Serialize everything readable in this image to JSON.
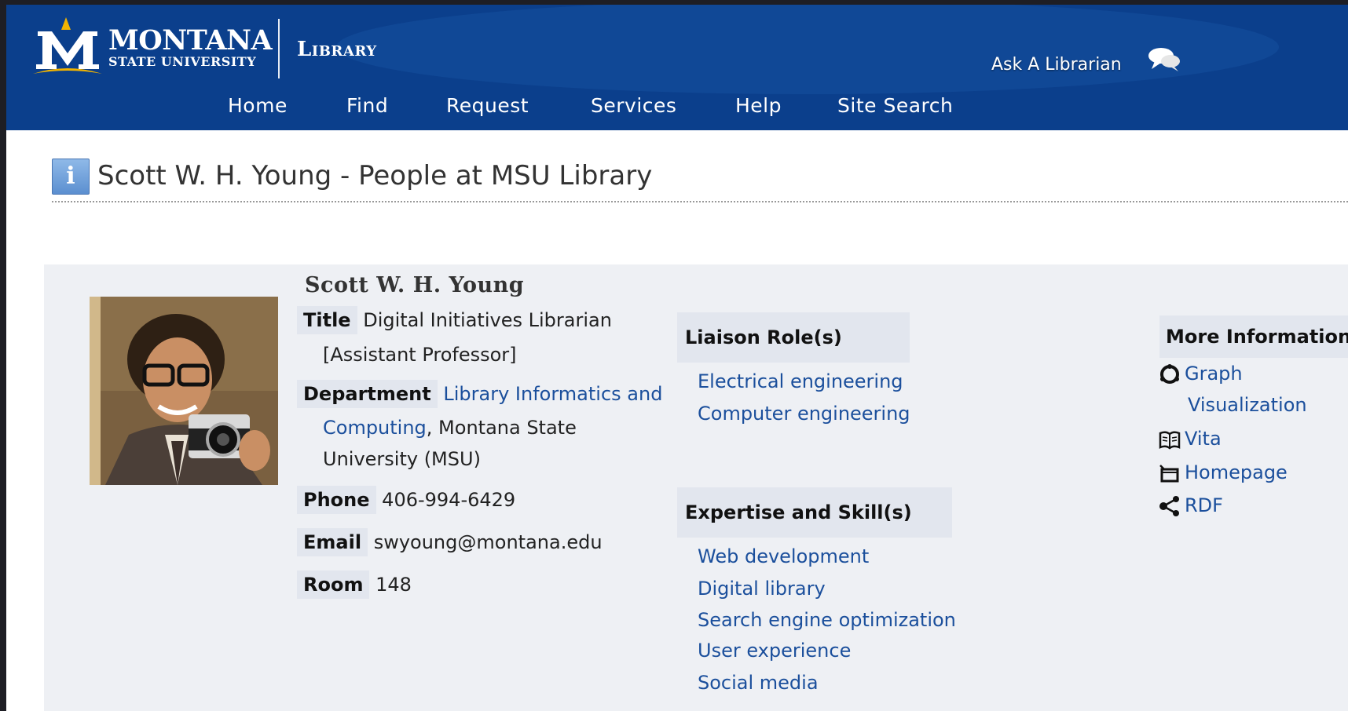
{
  "header": {
    "brand_big": "MONTANA",
    "brand_small": "STATE UNIVERSITY",
    "library_label": "Library",
    "ask_label": "Ask A Librarian",
    "colors": {
      "banner": "#0b3f8c",
      "gold": "#f2b400",
      "link": "#1b4f9c"
    }
  },
  "nav": {
    "items": [
      {
        "label": "Home"
      },
      {
        "label": "Find"
      },
      {
        "label": "Request"
      },
      {
        "label": "Services"
      },
      {
        "label": "Help"
      },
      {
        "label": "Site Search"
      }
    ]
  },
  "page": {
    "title": "Scott W. H. Young - People at MSU Library"
  },
  "person": {
    "name": "Scott W. H. Young",
    "title_label": "Title",
    "title_value_1": "Digital Initiatives Librarian",
    "title_value_2": "[Assistant Professor]",
    "department_label": "Department",
    "department_link_1": "Library Informatics and",
    "department_link_2": "Computing",
    "department_rest_1": ", Montana State",
    "department_rest_2": "University (MSU)",
    "phone_label": "Phone",
    "phone_value": "406-994-6429",
    "email_label": "Email",
    "email_value": "swyoung@montana.edu",
    "room_label": "Room",
    "room_value": "148"
  },
  "liaison": {
    "heading": "Liaison Role(s)",
    "items": [
      "Electrical engineering",
      "Computer engineering"
    ]
  },
  "expertise": {
    "heading": "Expertise and Skill(s)",
    "items": [
      "Web development",
      "Digital library",
      "Search engine optimization",
      "User experience",
      "Social media"
    ]
  },
  "more_info": {
    "heading": "More Information",
    "graph_1": "Graph",
    "graph_2": "Visualization",
    "vita": "Vita",
    "homepage": "Homepage",
    "rdf": "RDF",
    "icons": [
      "graph-icon",
      "book-icon",
      "homepage-icon",
      "share-icon"
    ]
  }
}
